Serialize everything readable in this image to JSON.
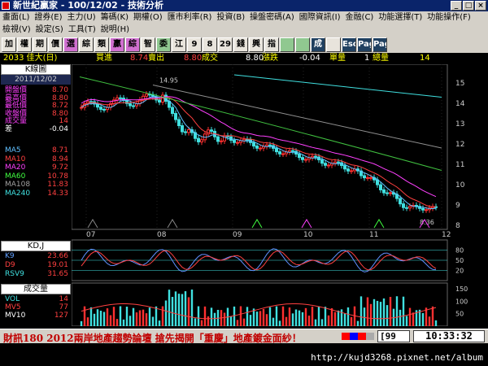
{
  "window": {
    "title": "新世紀贏家 - 100/12/02 - 技術分析"
  },
  "menu_row1": [
    "畫面(L)",
    "證券(E)",
    "主力(U)",
    "籌碼(K)",
    "期權(O)",
    "匯市利率(R)",
    "投資(B)",
    "操盤密碼(A)",
    "國際資訊(I)",
    "金融(C)",
    "功能選擇(T)",
    "功能操作(F)"
  ],
  "menu_row2": [
    "檢視(V)",
    "設定(S)",
    "工具(T)",
    "說明(H)"
  ],
  "toolbar": [
    "加",
    "權",
    "期",
    "價",
    "選",
    "綜",
    "類",
    "贏",
    "綜",
    "智",
    "委",
    "江",
    "9",
    "8",
    "29",
    "錢",
    "興",
    "指",
    "",
    "",
    "成",
    "",
    "Esc",
    "Page",
    "Page"
  ],
  "info": {
    "stock": "2033 佳大(日)",
    "buy_label": "買進",
    "buy": "8.74",
    "sell_label": "賣出",
    "sell": "8.80",
    "deal_label": "成交",
    "deal": "8.80",
    "change_label": "漲跌",
    "change": "-0.04",
    "vol_label": "單量",
    "vol": "1",
    "total_label": "總量",
    "total": "14"
  },
  "panel": {
    "title": "K線圖",
    "date": "2011/12/02",
    "quote": [
      {
        "k": "開盤價",
        "v": "8.70",
        "c": "#ff40ff"
      },
      {
        "k": "最高價",
        "v": "8.80",
        "c": "#ff40ff"
      },
      {
        "k": "最低價",
        "v": "8.72",
        "c": "#ff40ff"
      },
      {
        "k": "收盤價",
        "v": "8.80",
        "c": "#ff40ff"
      },
      {
        "k": "成交量",
        "v": "14",
        "c": "#ff40ff"
      },
      {
        "k": "差",
        "v": "-0.04",
        "c": "#ffffff"
      }
    ],
    "ma": [
      {
        "k": "MA5",
        "v": "8.71",
        "c": "#60c0ff"
      },
      {
        "k": "MA10",
        "v": "8.94",
        "c": "#ff4040"
      },
      {
        "k": "MA20",
        "v": "9.72",
        "c": "#ff40ff"
      },
      {
        "k": "MA60",
        "v": "10.78",
        "c": "#40ff40"
      },
      {
        "k": "MA108",
        "v": "11.83",
        "c": "#a0a0a0"
      },
      {
        "k": "MA240",
        "v": "14.33",
        "c": "#40e0e0"
      }
    ],
    "kd_title": "KD,J",
    "kd": [
      {
        "k": "K9",
        "v": "23.66",
        "c": "#60a0ff"
      },
      {
        "k": "D9",
        "v": "19.01",
        "c": "#ff4040"
      },
      {
        "k": "RSV9",
        "v": "31.65",
        "c": "#40e0e0"
      }
    ],
    "vol_title": "成交量",
    "vol": [
      {
        "k": "VOL",
        "v": "14",
        "c": "#40e0e0"
      },
      {
        "k": "MV5",
        "v": "77",
        "c": "#ff4040"
      },
      {
        "k": "MV10",
        "v": "127",
        "c": "#ffffff"
      }
    ]
  },
  "chart_data": {
    "type": "candlestick",
    "x_labels": [
      "07",
      "08",
      "09",
      "10",
      "11",
      "12"
    ],
    "y_ticks": [
      8,
      9,
      10,
      11,
      12,
      13,
      14,
      15
    ],
    "high_label": "14.95",
    "low_label": "8.36",
    "kd_ticks": [
      20,
      50,
      80
    ],
    "vol_ticks": [
      50,
      100,
      150
    ],
    "indicator_text": "[99"
  },
  "status": {
    "ticker": "財訊180  2012兩岸地產趨勢論壇  搶先揭開「重慶」地產鍍金面紗！",
    "code": "99",
    "time": "10:33:32"
  },
  "watermark": "http://kujd3268.pixnet.net/album"
}
